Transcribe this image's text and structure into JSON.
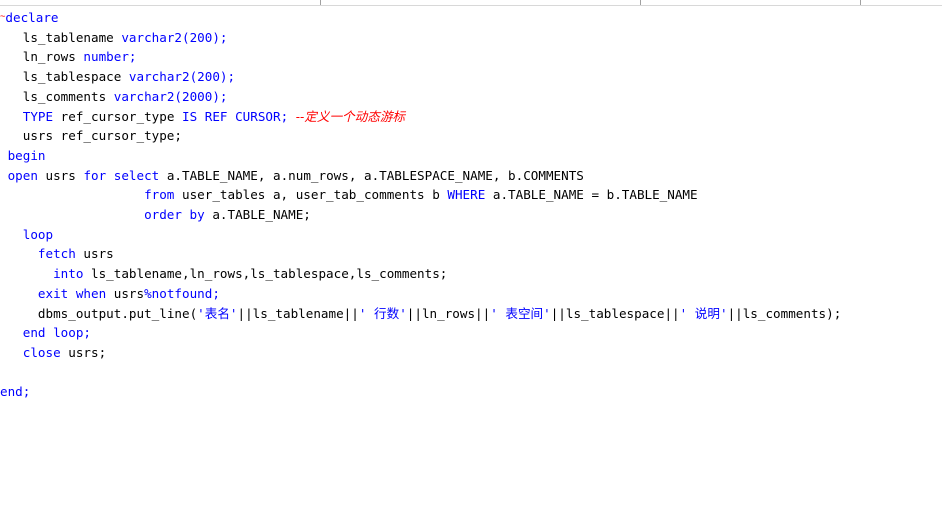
{
  "code_lines": [
    [
      {
        "t": "~",
        "c": "err"
      },
      {
        "t": "declare",
        "c": "kw"
      }
    ],
    [
      {
        "t": "   "
      },
      {
        "t": "ls_tablename",
        "c": "id"
      },
      {
        "t": " "
      },
      {
        "t": "varchar2(200);",
        "c": "kw"
      }
    ],
    [
      {
        "t": "   "
      },
      {
        "t": "ln_rows",
        "c": "id"
      },
      {
        "t": " "
      },
      {
        "t": "number;",
        "c": "kw"
      }
    ],
    [
      {
        "t": "   "
      },
      {
        "t": "ls_tablespace",
        "c": "id"
      },
      {
        "t": " "
      },
      {
        "t": "varchar2(200);",
        "c": "kw"
      }
    ],
    [
      {
        "t": "   "
      },
      {
        "t": "ls_comments",
        "c": "id"
      },
      {
        "t": " "
      },
      {
        "t": "varchar2(2000);",
        "c": "kw"
      }
    ],
    [
      {
        "t": "   "
      },
      {
        "t": "TYPE",
        "c": "kw"
      },
      {
        "t": " ref_cursor_type ",
        "c": "id"
      },
      {
        "t": "IS REF CURSOR;",
        "c": "kw"
      },
      {
        "t": " "
      },
      {
        "t": "--定义一个动态游标",
        "c": "cm"
      }
    ],
    [
      {
        "t": "   "
      },
      {
        "t": "usrs ref_cursor_type;",
        "c": "id"
      }
    ],
    [
      {
        "t": " "
      },
      {
        "t": "begin",
        "c": "kw"
      }
    ],
    [
      {
        "t": " "
      },
      {
        "t": "open",
        "c": "kw"
      },
      {
        "t": " usrs ",
        "c": "id"
      },
      {
        "t": "for select",
        "c": "kw"
      },
      {
        "t": " a.TABLE_NAME, a.num_rows, a.TABLESPACE_NAME, b.COMMENTS",
        "c": "id"
      }
    ],
    [
      {
        "t": "                   "
      },
      {
        "t": "from",
        "c": "kw"
      },
      {
        "t": " user_tables a, user_tab_comments b ",
        "c": "id"
      },
      {
        "t": "WHERE",
        "c": "kw"
      },
      {
        "t": " a.TABLE_NAME = b.TABLE_NAME",
        "c": "id"
      }
    ],
    [
      {
        "t": "                   "
      },
      {
        "t": "order by",
        "c": "kw"
      },
      {
        "t": " a.TABLE_NAME;",
        "c": "id"
      }
    ],
    [
      {
        "t": "   "
      },
      {
        "t": "loop",
        "c": "kw"
      }
    ],
    [
      {
        "t": "     "
      },
      {
        "t": "fetch",
        "c": "kw"
      },
      {
        "t": " usrs",
        "c": "id"
      }
    ],
    [
      {
        "t": "       "
      },
      {
        "t": "into",
        "c": "kw"
      },
      {
        "t": " ls_tablename,ln_rows,ls_tablespace,ls_comments;",
        "c": "id"
      }
    ],
    [
      {
        "t": "     "
      },
      {
        "t": "exit when",
        "c": "kw"
      },
      {
        "t": " usrs",
        "c": "id"
      },
      {
        "t": "%notfound;",
        "c": "kw"
      }
    ],
    [
      {
        "t": "     "
      },
      {
        "t": "dbms_output.put_line(",
        "c": "id"
      },
      {
        "t": "'表名'",
        "c": "str"
      },
      {
        "t": "||ls_tablename||",
        "c": "id"
      },
      {
        "t": "' 行数'",
        "c": "str"
      },
      {
        "t": "||ln_rows||",
        "c": "id"
      },
      {
        "t": "' 表空间'",
        "c": "str"
      },
      {
        "t": "||ls_tablespace||",
        "c": "id"
      },
      {
        "t": "' 说明'",
        "c": "str"
      },
      {
        "t": "||ls_comments);",
        "c": "id"
      }
    ],
    [
      {
        "t": "   "
      },
      {
        "t": "end loop;",
        "c": "kw"
      }
    ],
    [
      {
        "t": "   "
      },
      {
        "t": "close",
        "c": "kw"
      },
      {
        "t": " usrs;",
        "c": "id"
      }
    ],
    [],
    [
      {
        "t": "end;",
        "c": "kw"
      }
    ]
  ]
}
